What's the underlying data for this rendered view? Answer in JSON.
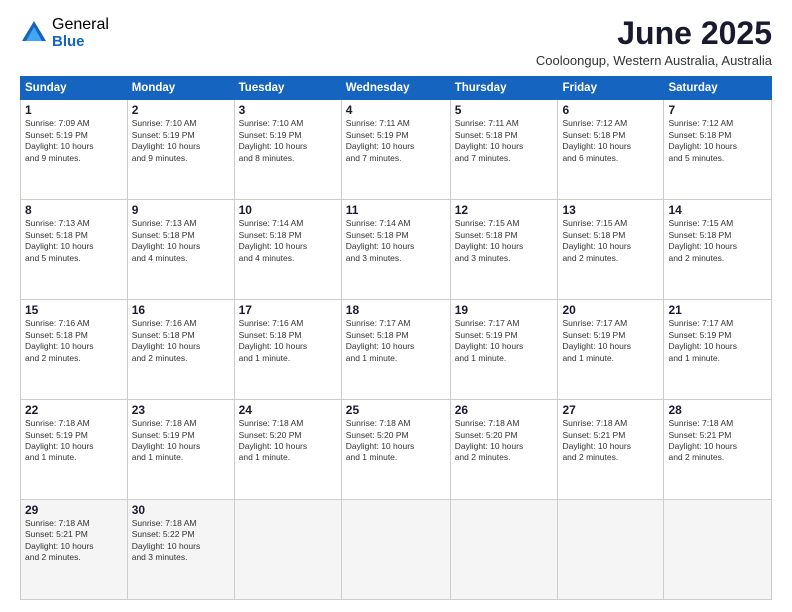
{
  "logo": {
    "general": "General",
    "blue": "Blue"
  },
  "header": {
    "title": "June 2025",
    "location": "Cooloongup, Western Australia, Australia"
  },
  "weekdays": [
    "Sunday",
    "Monday",
    "Tuesday",
    "Wednesday",
    "Thursday",
    "Friday",
    "Saturday"
  ],
  "weeks": [
    [
      {
        "day": "1",
        "info": "Sunrise: 7:09 AM\nSunset: 5:19 PM\nDaylight: 10 hours\nand 9 minutes."
      },
      {
        "day": "2",
        "info": "Sunrise: 7:10 AM\nSunset: 5:19 PM\nDaylight: 10 hours\nand 9 minutes."
      },
      {
        "day": "3",
        "info": "Sunrise: 7:10 AM\nSunset: 5:19 PM\nDaylight: 10 hours\nand 8 minutes."
      },
      {
        "day": "4",
        "info": "Sunrise: 7:11 AM\nSunset: 5:19 PM\nDaylight: 10 hours\nand 7 minutes."
      },
      {
        "day": "5",
        "info": "Sunrise: 7:11 AM\nSunset: 5:18 PM\nDaylight: 10 hours\nand 7 minutes."
      },
      {
        "day": "6",
        "info": "Sunrise: 7:12 AM\nSunset: 5:18 PM\nDaylight: 10 hours\nand 6 minutes."
      },
      {
        "day": "7",
        "info": "Sunrise: 7:12 AM\nSunset: 5:18 PM\nDaylight: 10 hours\nand 5 minutes."
      }
    ],
    [
      {
        "day": "8",
        "info": "Sunrise: 7:13 AM\nSunset: 5:18 PM\nDaylight: 10 hours\nand 5 minutes."
      },
      {
        "day": "9",
        "info": "Sunrise: 7:13 AM\nSunset: 5:18 PM\nDaylight: 10 hours\nand 4 minutes."
      },
      {
        "day": "10",
        "info": "Sunrise: 7:14 AM\nSunset: 5:18 PM\nDaylight: 10 hours\nand 4 minutes."
      },
      {
        "day": "11",
        "info": "Sunrise: 7:14 AM\nSunset: 5:18 PM\nDaylight: 10 hours\nand 3 minutes."
      },
      {
        "day": "12",
        "info": "Sunrise: 7:15 AM\nSunset: 5:18 PM\nDaylight: 10 hours\nand 3 minutes."
      },
      {
        "day": "13",
        "info": "Sunrise: 7:15 AM\nSunset: 5:18 PM\nDaylight: 10 hours\nand 2 minutes."
      },
      {
        "day": "14",
        "info": "Sunrise: 7:15 AM\nSunset: 5:18 PM\nDaylight: 10 hours\nand 2 minutes."
      }
    ],
    [
      {
        "day": "15",
        "info": "Sunrise: 7:16 AM\nSunset: 5:18 PM\nDaylight: 10 hours\nand 2 minutes."
      },
      {
        "day": "16",
        "info": "Sunrise: 7:16 AM\nSunset: 5:18 PM\nDaylight: 10 hours\nand 2 minutes."
      },
      {
        "day": "17",
        "info": "Sunrise: 7:16 AM\nSunset: 5:18 PM\nDaylight: 10 hours\nand 1 minute."
      },
      {
        "day": "18",
        "info": "Sunrise: 7:17 AM\nSunset: 5:18 PM\nDaylight: 10 hours\nand 1 minute."
      },
      {
        "day": "19",
        "info": "Sunrise: 7:17 AM\nSunset: 5:19 PM\nDaylight: 10 hours\nand 1 minute."
      },
      {
        "day": "20",
        "info": "Sunrise: 7:17 AM\nSunset: 5:19 PM\nDaylight: 10 hours\nand 1 minute."
      },
      {
        "day": "21",
        "info": "Sunrise: 7:17 AM\nSunset: 5:19 PM\nDaylight: 10 hours\nand 1 minute."
      }
    ],
    [
      {
        "day": "22",
        "info": "Sunrise: 7:18 AM\nSunset: 5:19 PM\nDaylight: 10 hours\nand 1 minute."
      },
      {
        "day": "23",
        "info": "Sunrise: 7:18 AM\nSunset: 5:19 PM\nDaylight: 10 hours\nand 1 minute."
      },
      {
        "day": "24",
        "info": "Sunrise: 7:18 AM\nSunset: 5:20 PM\nDaylight: 10 hours\nand 1 minute."
      },
      {
        "day": "25",
        "info": "Sunrise: 7:18 AM\nSunset: 5:20 PM\nDaylight: 10 hours\nand 1 minute."
      },
      {
        "day": "26",
        "info": "Sunrise: 7:18 AM\nSunset: 5:20 PM\nDaylight: 10 hours\nand 2 minutes."
      },
      {
        "day": "27",
        "info": "Sunrise: 7:18 AM\nSunset: 5:21 PM\nDaylight: 10 hours\nand 2 minutes."
      },
      {
        "day": "28",
        "info": "Sunrise: 7:18 AM\nSunset: 5:21 PM\nDaylight: 10 hours\nand 2 minutes."
      }
    ],
    [
      {
        "day": "29",
        "info": "Sunrise: 7:18 AM\nSunset: 5:21 PM\nDaylight: 10 hours\nand 2 minutes."
      },
      {
        "day": "30",
        "info": "Sunrise: 7:18 AM\nSunset: 5:22 PM\nDaylight: 10 hours\nand 3 minutes."
      },
      {
        "day": "",
        "info": ""
      },
      {
        "day": "",
        "info": ""
      },
      {
        "day": "",
        "info": ""
      },
      {
        "day": "",
        "info": ""
      },
      {
        "day": "",
        "info": ""
      }
    ]
  ]
}
